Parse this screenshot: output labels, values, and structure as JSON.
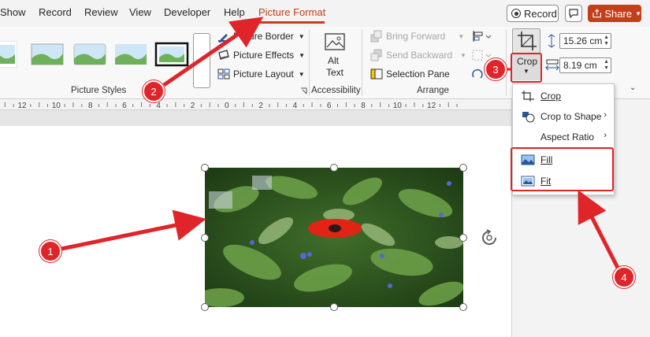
{
  "menubar": {
    "tabs": [
      "Show",
      "Record",
      "Review",
      "View",
      "Developer",
      "Help",
      "Picture Format"
    ],
    "active_tab": "Picture Format",
    "record_label": "Record",
    "share_label": "Share"
  },
  "ribbon": {
    "picture_styles": {
      "label": "Picture Styles",
      "border": "Picture Border",
      "effects": "Picture Effects",
      "layout": "Picture Layout"
    },
    "accessibility": {
      "label": "Accessibility",
      "alt_text_line1": "Alt",
      "alt_text_line2": "Text"
    },
    "arrange": {
      "label": "Arrange",
      "bring_forward": "Bring Forward",
      "send_backward": "Send Backward",
      "selection_pane": "Selection Pane"
    },
    "size": {
      "crop_label": "Crop",
      "height": "15.26 cm",
      "width": "8.19 cm"
    }
  },
  "ruler": {
    "labels": [
      "12",
      "10",
      "8",
      "6",
      "4",
      "2",
      "0",
      "2",
      "4",
      "6",
      "8",
      "10",
      "12"
    ]
  },
  "crop_menu": {
    "items": [
      "Crop",
      "Crop to Shape",
      "Aspect Ratio",
      "Fill",
      "Fit"
    ]
  },
  "annotations": {
    "badges": [
      "1",
      "2",
      "3",
      "4"
    ]
  },
  "colors": {
    "accent": "#c43e1c",
    "annotation": "#e0252a"
  }
}
